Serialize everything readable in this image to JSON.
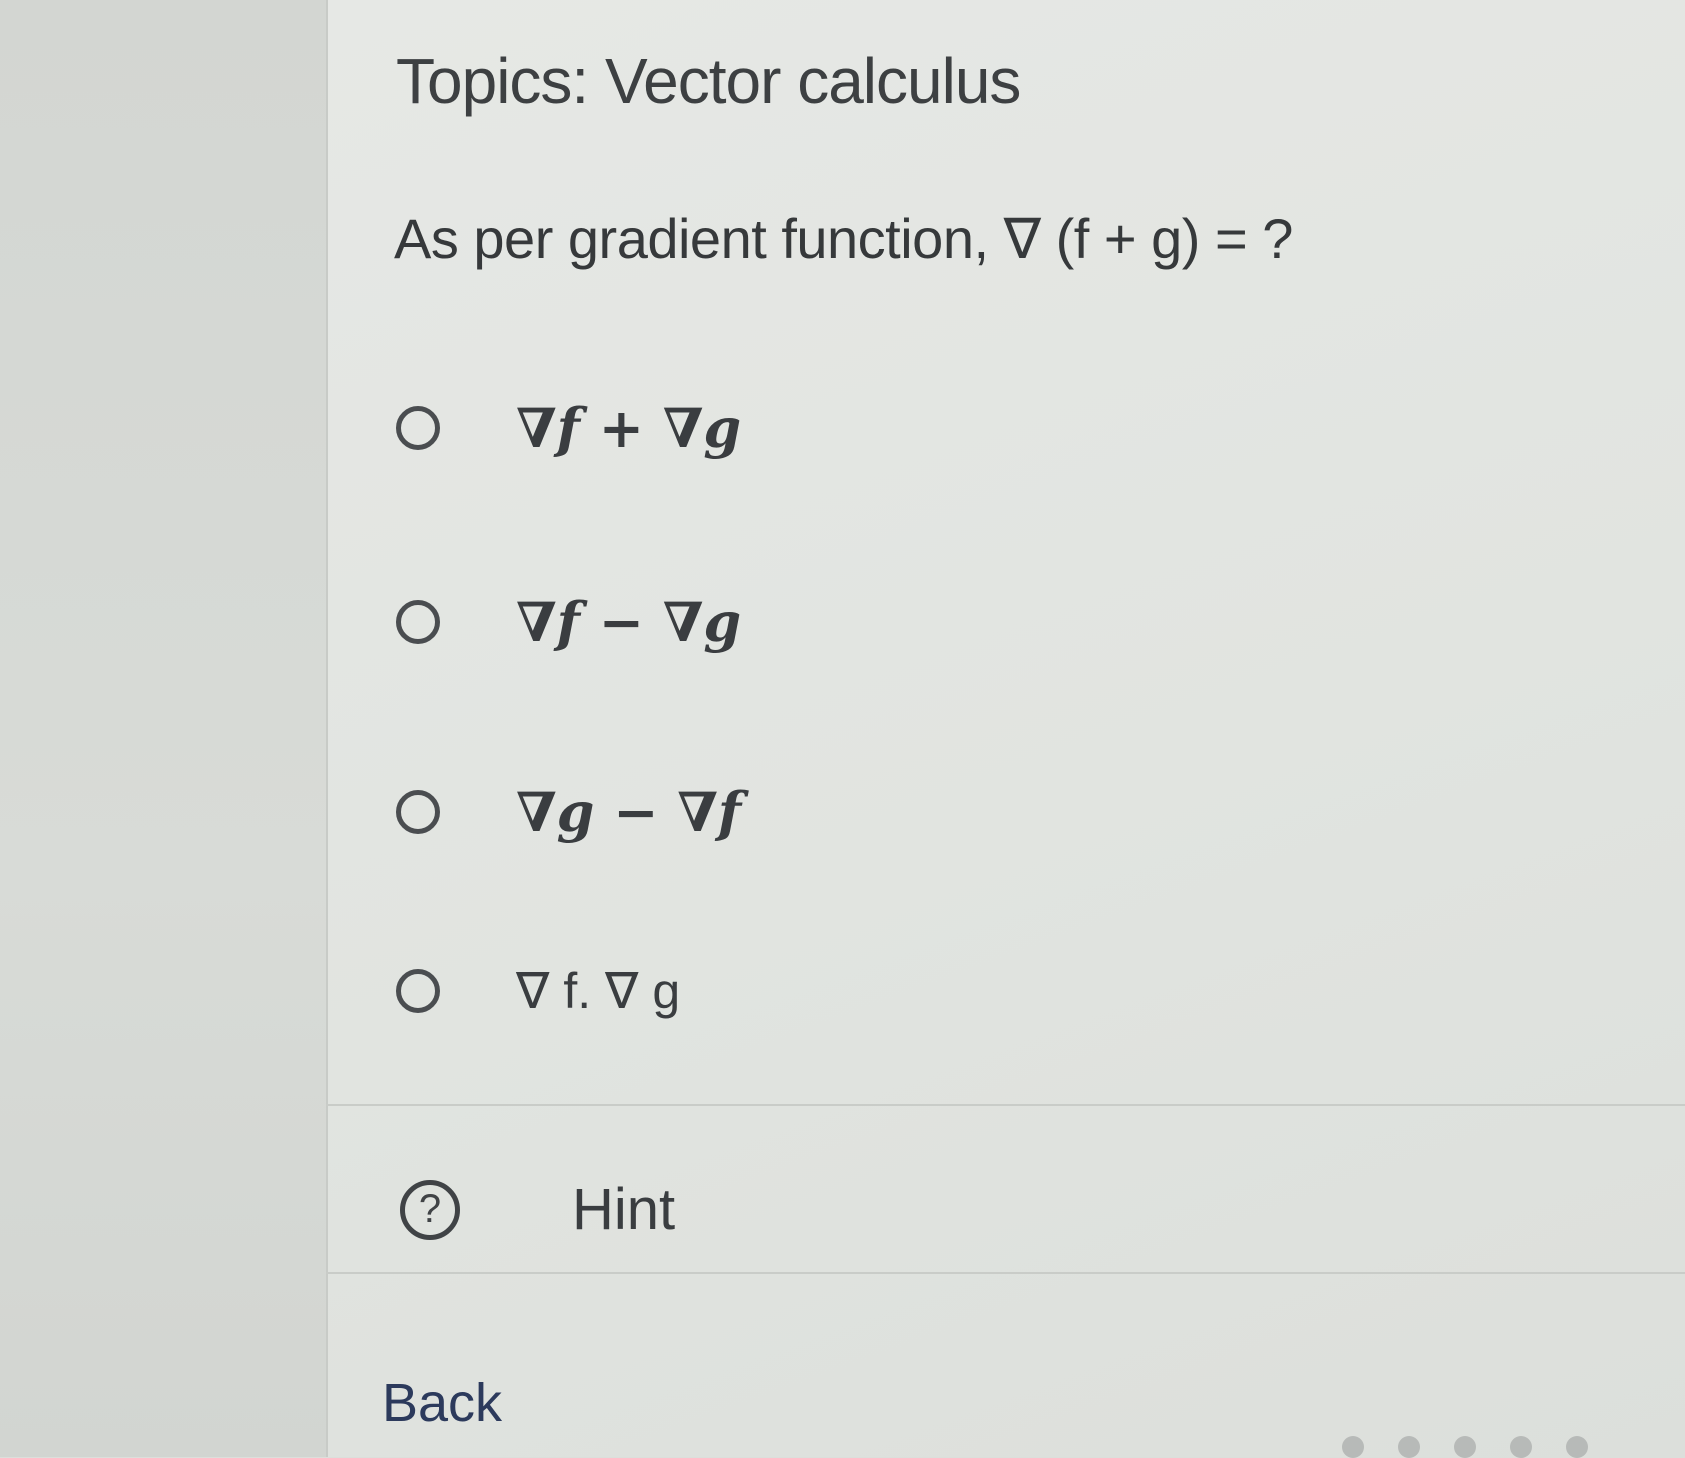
{
  "topics": {
    "label": "Topics: Vector calculus"
  },
  "question": {
    "text": "As per gradient function, ∇ (f + g) = ?"
  },
  "options": [
    {
      "label": "∇f + ∇g"
    },
    {
      "label": "∇f − ∇g"
    },
    {
      "label": "∇g − ∇f"
    },
    {
      "label": "∇ f. ∇ g"
    }
  ],
  "hint": {
    "icon_glyph": "?",
    "label": "Hint",
    "icon": "question-circle-icon"
  },
  "navigation": {
    "back_label": "Back"
  },
  "colors": {
    "link": "#2c3a5c",
    "text": "#3a3d40",
    "background": "#e2e5e1"
  }
}
